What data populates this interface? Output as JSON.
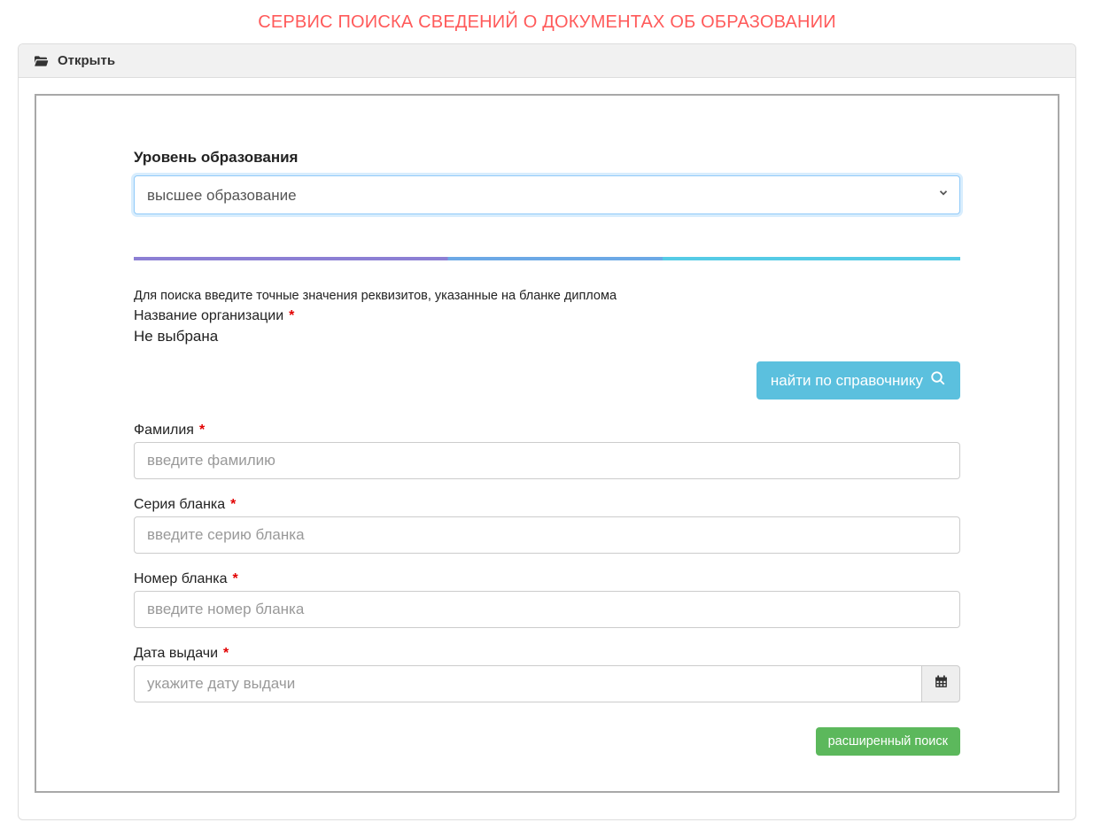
{
  "page": {
    "title": "СЕРВИС ПОИСКА СВЕДЕНИЙ О ДОКУМЕНТАХ ОБ ОБРАЗОВАНИИ"
  },
  "panel": {
    "open_label": "Открыть"
  },
  "form": {
    "education_level_label": "Уровень образования",
    "education_level_value": "высшее образование",
    "hint": "Для поиска введите точные значения реквизитов, указанные на бланке диплома",
    "organization_label": "Название организации",
    "organization_value": "Не выбрана",
    "find_in_directory_label": "найти по справочнику",
    "surname_label": "Фамилия",
    "surname_placeholder": "введите фамилию",
    "blank_series_label": "Серия бланка",
    "blank_series_placeholder": "введите серию бланка",
    "blank_number_label": "Номер бланка",
    "blank_number_placeholder": "введите номер бланка",
    "issue_date_label": "Дата выдачи",
    "issue_date_placeholder": "укажите дату выдачи",
    "extended_search_label": "расширенный поиск",
    "required_mark": "*"
  }
}
